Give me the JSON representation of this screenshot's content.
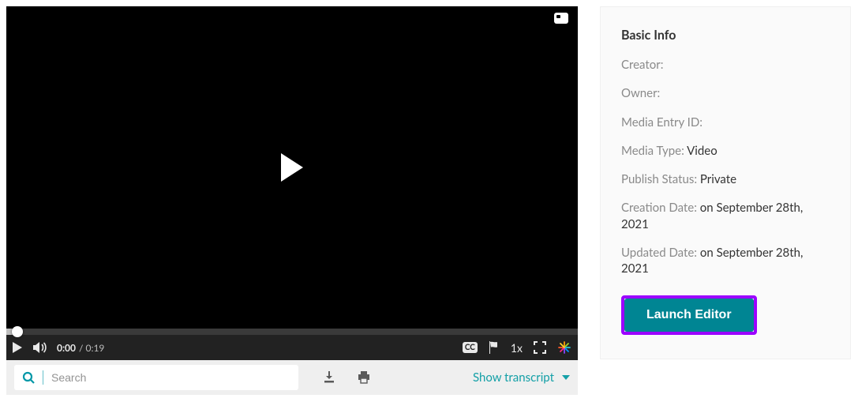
{
  "player": {
    "current_time": "0:00",
    "duration_prefix": "/",
    "duration": "0:19",
    "cc_label": "CC",
    "speed_label": "1x"
  },
  "toolbar": {
    "search_placeholder": "Search",
    "show_transcript_label": "Show transcript"
  },
  "panel": {
    "heading": "Basic Info",
    "fields": {
      "creator": {
        "label": "Creator:",
        "value": ""
      },
      "owner": {
        "label": "Owner:",
        "value": ""
      },
      "media_entry_id": {
        "label": "Media Entry ID:",
        "value": ""
      },
      "media_type": {
        "label": "Media Type:",
        "value": "Video"
      },
      "publish_status": {
        "label": "Publish Status:",
        "value": "Private"
      },
      "creation_date": {
        "label": "Creation Date:",
        "value": "on September 28th, 2021"
      },
      "updated_date": {
        "label": "Updated Date:",
        "value": "on September 28th, 2021"
      }
    },
    "launch_label": "Launch Editor"
  }
}
